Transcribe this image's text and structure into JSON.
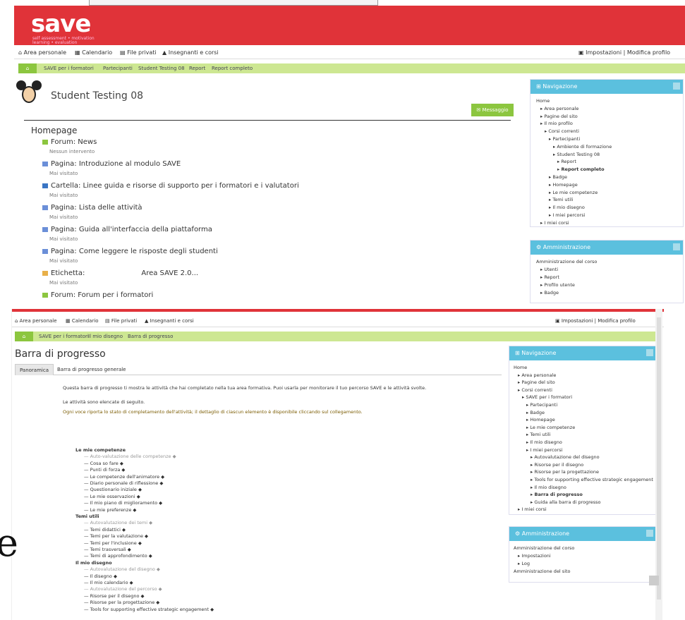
{
  "shot1": {
    "logo": "save",
    "logo_sub": "self assessment • motivation learning • evaluation",
    "nav": [
      "Area personale",
      "Calendario",
      "File privati",
      "Insegnanti e corsi"
    ],
    "nav_right": "Impostazioni | Modifica profilo",
    "crumbs": [
      "SAVE per i formatori",
      "Partecipanti",
      "Student Testing 08",
      "Report",
      "Report completo"
    ],
    "title": "Student Testing 08",
    "message_btn": "Messaggio",
    "section": "Homepage",
    "courses": [
      {
        "label": "Forum: News",
        "sub": "Nessun intervento",
        "color": "#8cc63f"
      },
      {
        "label": "Pagina: Introduzione al modulo SAVE",
        "sub": "Mai visitato",
        "color": "#6b8fd8"
      },
      {
        "label": "Cartella: Linee guida e risorse di supporto per i formatori e i valutatori",
        "sub": "Mai visitato",
        "color": "#3a75c4"
      },
      {
        "label": "Pagina: Lista delle attività",
        "sub": "Mai visitato",
        "color": "#6b8fd8"
      },
      {
        "label": "Pagina: Guida all'interfaccia della piattaforma",
        "sub": "Mai visitato",
        "color": "#6b8fd8"
      },
      {
        "label": "Pagina: Come leggere le risposte degli studenti",
        "sub": "Mai visitato",
        "color": "#6b8fd8"
      },
      {
        "label": "Etichetta:",
        "extra": "Area SAVE 2.0...",
        "sub": "Mai visitato",
        "color": "#e8b04a"
      },
      {
        "label": "Forum: Forum per i formatori",
        "sub": "",
        "color": "#8cc63f"
      }
    ],
    "navigation_block": {
      "title": "Navigazione",
      "items": [
        {
          "t": "Home",
          "d": 0
        },
        {
          "t": "Area personale",
          "d": 1
        },
        {
          "t": "Pagine del sito",
          "d": 1
        },
        {
          "t": "Il mio profilo",
          "d": 1
        },
        {
          "t": "Corsi correnti",
          "d": 2
        },
        {
          "t": "Partecipanti",
          "d": 3
        },
        {
          "t": "Ambiente di formazione",
          "d": 4
        },
        {
          "t": "Student Testing 08",
          "d": 4
        },
        {
          "t": "Report",
          "d": 5
        },
        {
          "t": "Report completo",
          "d": 5,
          "b": true
        },
        {
          "t": "Badge",
          "d": 3
        },
        {
          "t": "Homepage",
          "d": 3
        },
        {
          "t": "Le mie competenze",
          "d": 3
        },
        {
          "t": "Temi utili",
          "d": 3
        },
        {
          "t": "Il mio disegno",
          "d": 3
        },
        {
          "t": "I miei percorsi",
          "d": 3
        },
        {
          "t": "I miei corsi",
          "d": 1
        }
      ]
    },
    "admin_block": {
      "title": "Amministrazione",
      "items": [
        {
          "t": "Amministrazione del corso",
          "d": 0
        },
        {
          "t": "Utenti",
          "d": 1
        },
        {
          "t": "Report",
          "d": 1
        },
        {
          "t": "Profilo utente",
          "d": 1
        },
        {
          "t": "Badge",
          "d": 1
        }
      ]
    }
  },
  "shot2": {
    "nav": [
      "Area personale",
      "Calendario",
      "File privati",
      "Insegnanti e corsi"
    ],
    "nav_right": "Impostazioni | Modifica profilo",
    "crumbs": [
      "SAVE per i formatori",
      "Il mio disegno",
      "Barra di progresso"
    ],
    "title": "Barra di progresso",
    "tabs": [
      "Panoramica",
      "Barra di progresso generale"
    ],
    "paragraphs": [
      "Questa barra di progresso ti mostra le attività che hai completato nella tua area formativa. Puoi usarla per monitorare il tuo percorso SAVE e le attività svolte.",
      "Le attività sono elencate di seguito.",
      "Ogni voce riporta lo stato di completamento dell'attività; il dettaglio di ciascun elemento è disponibile cliccando sul collegamento."
    ],
    "progress": [
      {
        "t": "Le mie competenze",
        "b": true,
        "d": 0
      },
      {
        "t": "Auto-valutazione delle competenze",
        "d": 1,
        "grey": true
      },
      {
        "t": "Cosa so fare",
        "d": 1
      },
      {
        "t": "Punti di forza",
        "d": 1
      },
      {
        "t": "Le competenze dell'animatore",
        "d": 1
      },
      {
        "t": "Diario personale di riflessione",
        "d": 1
      },
      {
        "t": "Questionario iniziale",
        "d": 1
      },
      {
        "t": "Le mie osservazioni",
        "d": 1
      },
      {
        "t": "Il mio piano di miglioramento",
        "d": 1
      },
      {
        "t": "Le mie preferenze",
        "d": 1
      },
      {
        "t": "Temi utili",
        "b": true,
        "d": 0
      },
      {
        "t": "Autovalutazione dei temi",
        "d": 1,
        "grey": true
      },
      {
        "t": "Temi didattici",
        "d": 1
      },
      {
        "t": "Temi per la valutazione",
        "d": 1
      },
      {
        "t": "Temi per l'inclusione",
        "d": 1
      },
      {
        "t": "Temi trasversali",
        "d": 1
      },
      {
        "t": "Temi di approfondimento",
        "d": 1
      },
      {
        "t": "Il mio disegno",
        "b": true,
        "d": 0
      },
      {
        "t": "Autovalutazione del disegno",
        "d": 1,
        "grey": true
      },
      {
        "t": "Il disegno",
        "d": 1
      },
      {
        "t": "Il mio calendario",
        "d": 1
      },
      {
        "t": "Autovalutazione del percorso",
        "d": 1,
        "grey": true
      },
      {
        "t": "Risorse per il disegno",
        "d": 1
      },
      {
        "t": "Risorse per la progettazione",
        "d": 1
      },
      {
        "t": "Tools for supporting effective strategic engagement",
        "d": 1
      }
    ],
    "navigation_block": {
      "title": "Navigazione",
      "items": [
        {
          "t": "Home",
          "d": 0
        },
        {
          "t": "Area personale",
          "d": 1
        },
        {
          "t": "Pagine del sito",
          "d": 1
        },
        {
          "t": "Corsi correnti",
          "d": 1
        },
        {
          "t": "SAVE per i formatori",
          "d": 2
        },
        {
          "t": "Partecipanti",
          "d": 3
        },
        {
          "t": "Badge",
          "d": 3
        },
        {
          "t": "Homepage",
          "d": 3
        },
        {
          "t": "Le mie competenze",
          "d": 3
        },
        {
          "t": "Temi utili",
          "d": 3
        },
        {
          "t": "Il mio disegno",
          "d": 3
        },
        {
          "t": "I miei percorsi",
          "d": 3
        },
        {
          "t": "Autovalutazione del disegno",
          "d": 4
        },
        {
          "t": "Risorse per il disegno",
          "d": 4
        },
        {
          "t": "Risorse per la progettazione",
          "d": 4
        },
        {
          "t": "Tools for supporting effective strategic engagement",
          "d": 4
        },
        {
          "t": "Il mio disegno",
          "d": 4
        },
        {
          "t": "Barra di progresso",
          "d": 4,
          "b": true
        },
        {
          "t": "Guida alla barra di progresso",
          "d": 4
        },
        {
          "t": "I miei corsi",
          "d": 1
        }
      ]
    },
    "admin_block": {
      "title": "Amministrazione",
      "items": [
        {
          "t": "Amministrazione del corso",
          "d": 0
        },
        {
          "t": "Impostazioni",
          "d": 1
        },
        {
          "t": "Log",
          "d": 1
        },
        {
          "t": "Amministrazione del sito",
          "d": 0
        }
      ]
    }
  },
  "colors": {
    "brand_red": "#e03339",
    "crumb_green": "#cde792",
    "accent_green": "#8cc63f",
    "block_blue": "#5bc0de"
  },
  "icons": {
    "nav_home": "home-icon",
    "calendar": "calendar-icon",
    "files": "file-icon",
    "users": "users-icon",
    "block": "sitemap-icon",
    "gear": "gear-icon"
  },
  "edge_letter": "e"
}
